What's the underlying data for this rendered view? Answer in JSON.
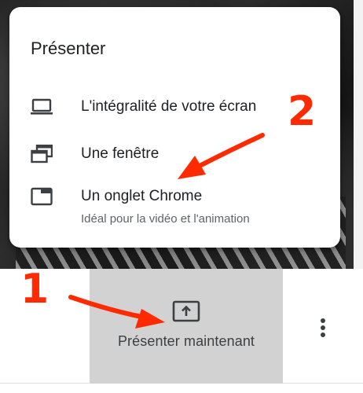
{
  "menu": {
    "title": "Présenter",
    "items": [
      {
        "label": "L'intégralité de votre écran",
        "icon": "laptop-icon"
      },
      {
        "label": "Une fenêtre",
        "icon": "window-icon"
      },
      {
        "label": "Un onglet Chrome",
        "sublabel": "Idéal pour la vidéo et l'animation",
        "icon": "tab-icon"
      }
    ]
  },
  "toolbar": {
    "present_label": "Présenter maintenant",
    "present_icon": "present-screen-icon",
    "more_icon": "more-vert-icon"
  },
  "annotations": {
    "step_1": "1",
    "step_2": "2",
    "color": "#ff2a00"
  }
}
